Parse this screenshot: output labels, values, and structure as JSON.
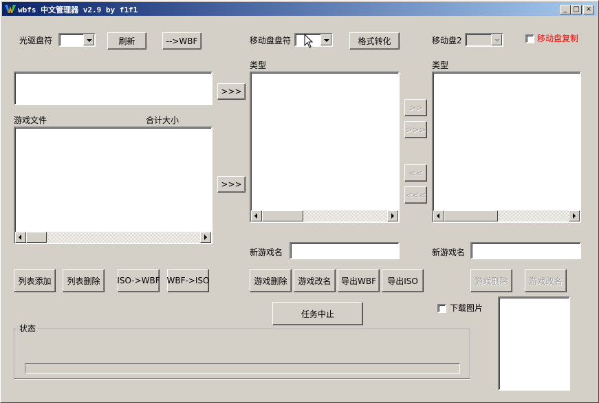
{
  "window": {
    "title": "wbfs 中文管理器 v2.9 by f1f1",
    "minimize": "_",
    "maximize": "□",
    "close": "×"
  },
  "drive": {
    "label": "光驱盘符",
    "value": "",
    "refresh": "刷新",
    "to_wbf": "-->WBF"
  },
  "usb1": {
    "label": "移动盘盘符",
    "value": "",
    "convert": "格式转化",
    "type_label": "类型",
    "new_name_label": "新游戏名",
    "new_name_value": "",
    "buttons": {
      "delete": "游戏删除",
      "rename": "游戏改名",
      "export_wbf": "导出WBF",
      "export_iso": "导出ISO"
    }
  },
  "usb2": {
    "label": "移动盘2",
    "value": "",
    "copy_label": "移动盘复制",
    "type_label": "类型",
    "new_name_label": "新游戏名",
    "new_name_value": "",
    "buttons": {
      "delete": "游戏删除",
      "rename": "游戏改名"
    }
  },
  "left": {
    "file_col": "游戏文件",
    "size_col": "合计大小",
    "buttons": {
      "list_add": "列表添加",
      "list_delete": "列表删除",
      "iso_to_wbf": "ISO->WBF",
      "wbf_to_iso": "WBF->ISO"
    }
  },
  "transfer": {
    "to_usb": ">>>",
    "right_one": ">>",
    "right_all": ">>>",
    "left_one": "<<",
    "left_all": "<<<"
  },
  "task": {
    "stop": "任务中止",
    "download_images": "下载图片"
  },
  "status": {
    "label": "状态",
    "progress": 0
  },
  "colors": {
    "face": "#d4d0c8",
    "title_start": "#0a246a",
    "title_end": "#a6caf0",
    "copy_label": "#ff0000",
    "disabled_text": "#a0a0a0"
  }
}
